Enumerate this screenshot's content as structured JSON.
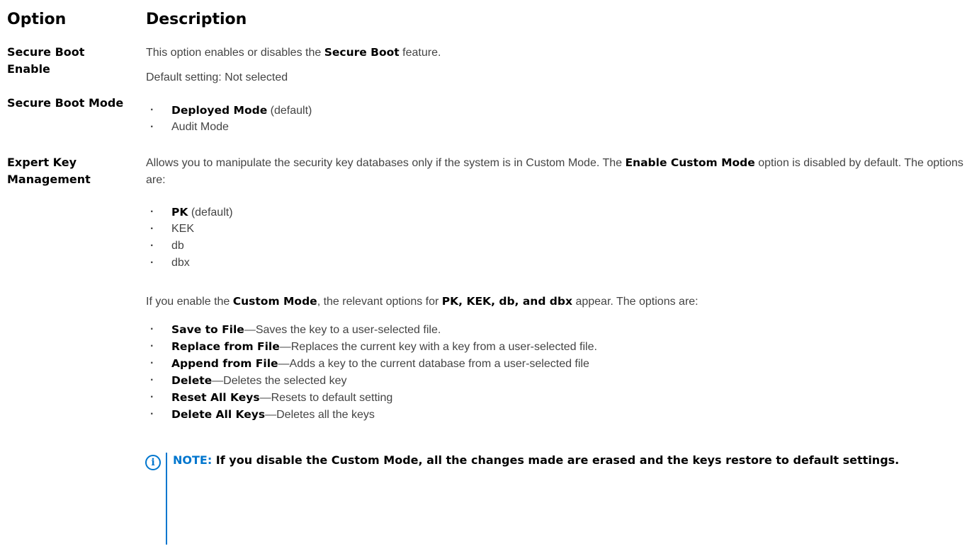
{
  "header": {
    "option": "Option",
    "description": "Description"
  },
  "secure_boot_enable": {
    "option_line1": "Secure Boot",
    "option_line2": "Enable",
    "desc_pre": "This option enables or disables the ",
    "desc_bold": "Secure Boot",
    "desc_post": " feature.",
    "default": "Default setting: Not selected"
  },
  "secure_boot_mode": {
    "option": "Secure Boot Mode",
    "items": [
      {
        "bold": "Deployed Mode",
        "text": " (default)"
      },
      {
        "bold": "",
        "text": "Audit Mode"
      }
    ]
  },
  "expert_key": {
    "option_line1": "Expert Key",
    "option_line2": "Management",
    "p1_pre": "Allows you to manipulate the security key databases only if the system is in Custom Mode. The ",
    "p1_bold": "Enable Custom Mode",
    "p1_post": " option is disabled by default. The options are:",
    "key_items": [
      {
        "bold": "PK",
        "text": " (default)"
      },
      {
        "bold": "",
        "text": "KEK"
      },
      {
        "bold": "",
        "text": "db"
      },
      {
        "bold": "",
        "text": "dbx"
      }
    ],
    "p2_pre": "If you enable the ",
    "p2_bold1": "Custom Mode",
    "p2_mid": ", the relevant options for ",
    "p2_bold2": "PK, KEK, db, and dbx",
    "p2_post": " appear. The options are:",
    "action_items": [
      {
        "bold": "Save to File",
        "text": "—Saves the key to a user-selected file."
      },
      {
        "bold": "Replace from File",
        "text": "—Replaces the current key with a key from a user-selected file."
      },
      {
        "bold": "Append from File",
        "text": "—Adds a key to the current database from a user-selected file"
      },
      {
        "bold": "Delete",
        "text": "—Deletes the selected key"
      },
      {
        "bold": "Reset All Keys",
        "text": "—Resets to default setting"
      },
      {
        "bold": "Delete All Keys",
        "text": "—Deletes all the keys"
      }
    ],
    "note_label": "NOTE:",
    "note_text": " If you disable the Custom Mode, all the changes made are erased and the keys restore to default settings."
  },
  "icons": {
    "note": "info-icon"
  },
  "colors": {
    "accent": "#0076ce"
  }
}
